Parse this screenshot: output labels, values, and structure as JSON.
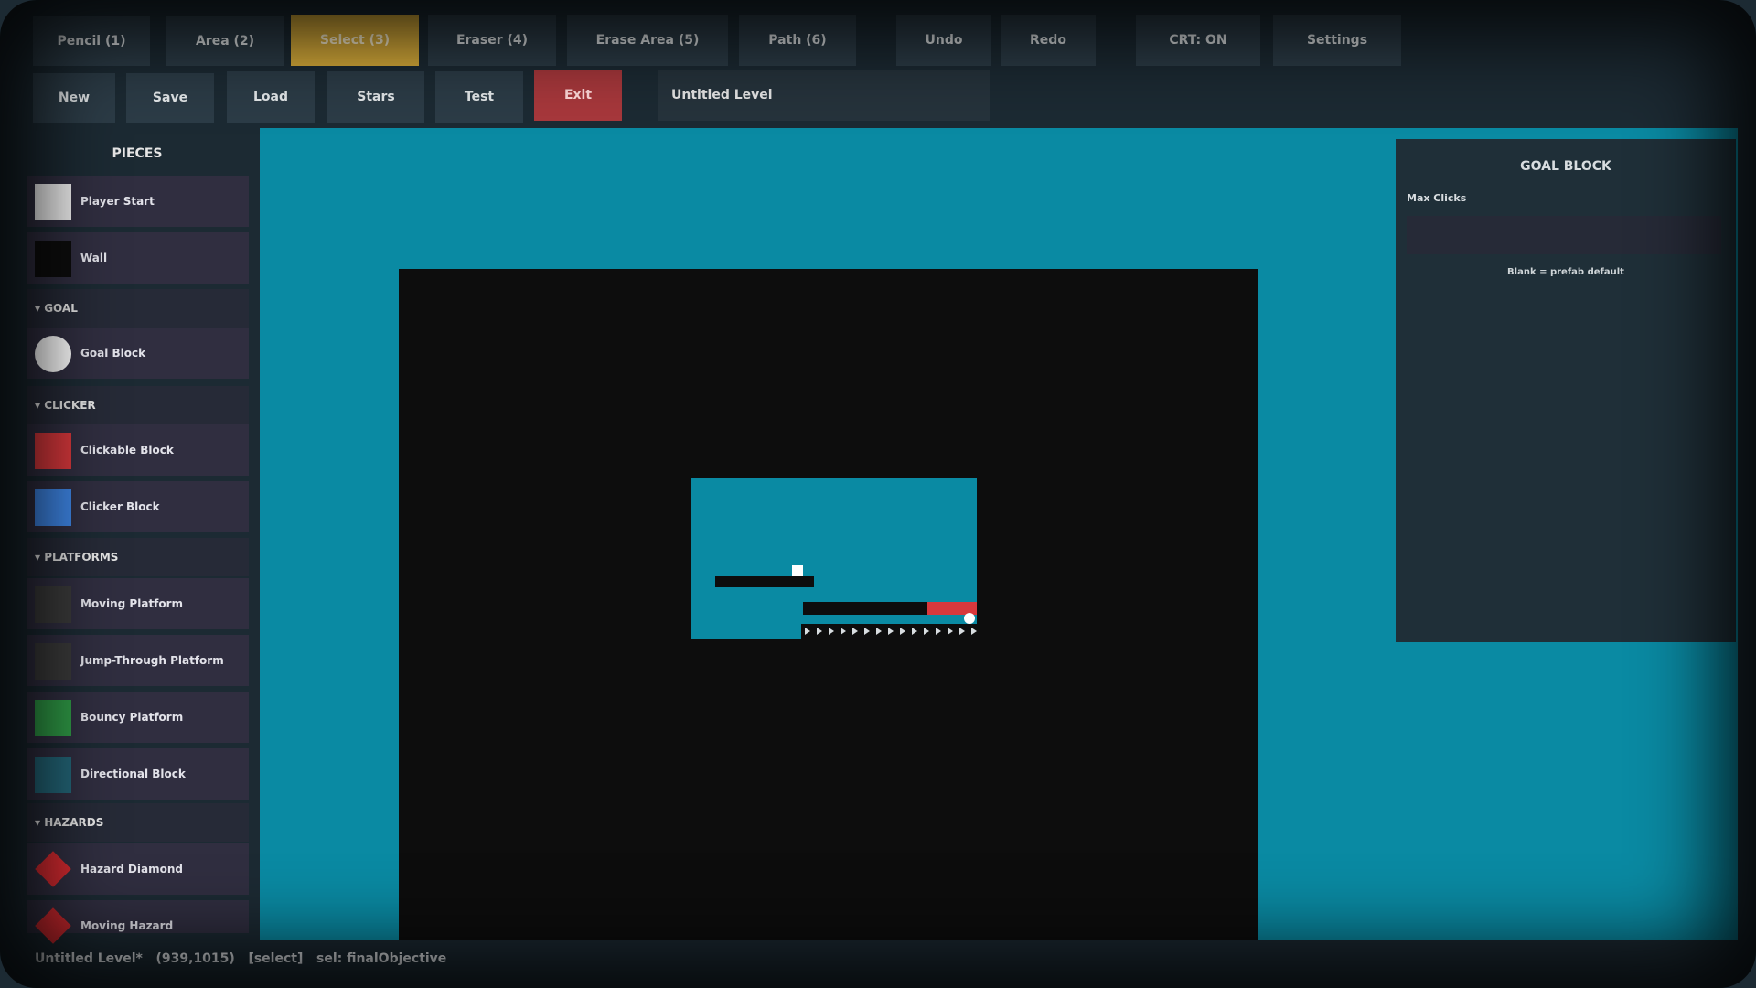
{
  "toolbar_row1": [
    {
      "label": "Pencil (1)",
      "active": false
    },
    {
      "label": "Area (2)",
      "active": false
    },
    {
      "label": "Select (3)",
      "active": true
    },
    {
      "label": "Eraser (4)",
      "active": false
    },
    {
      "label": "Erase Area (5)",
      "active": false
    },
    {
      "label": "Path (6)",
      "active": false
    },
    {
      "label": "Undo",
      "active": false
    },
    {
      "label": "Redo",
      "active": false
    },
    {
      "label": "CRT: ON",
      "active": false
    },
    {
      "label": "Settings",
      "active": false
    }
  ],
  "toolbar_row2": [
    {
      "label": "New"
    },
    {
      "label": "Save"
    },
    {
      "label": "Load"
    },
    {
      "label": "Stars"
    },
    {
      "label": "Test"
    },
    {
      "label": "Exit"
    }
  ],
  "level_name": "Untitled Level",
  "sidebar": {
    "title": "PIECES",
    "items": [
      {
        "type": "piece",
        "label": "Player Start",
        "color": "#f2f2f2",
        "icon": "square"
      },
      {
        "type": "piece",
        "label": "Wall",
        "color": "#0d0d0d",
        "icon": "square"
      },
      {
        "type": "category",
        "label": "▾ GOAL"
      },
      {
        "type": "piece",
        "label": "Goal Block",
        "color": "#ffffff",
        "icon": "circle"
      },
      {
        "type": "category",
        "label": "▾ CLICKER"
      },
      {
        "type": "piece",
        "label": "Clickable Block",
        "color": "#d8383c",
        "icon": "square"
      },
      {
        "type": "piece",
        "label": "Clicker Block",
        "color": "#3e86e6",
        "icon": "square"
      },
      {
        "type": "category",
        "label": "▾ PLATFORMS"
      },
      {
        "type": "piece",
        "label": "Moving Platform",
        "color": "#3a3a3a",
        "icon": "square"
      },
      {
        "type": "piece",
        "label": "Jump-Through Platform",
        "color": "#3a3a3a",
        "icon": "square"
      },
      {
        "type": "piece",
        "label": "Bouncy Platform",
        "color": "#2f9a46",
        "icon": "square"
      },
      {
        "type": "piece",
        "label": "Directional Block",
        "color": "#236577",
        "icon": "square"
      },
      {
        "type": "category",
        "label": "▾ HAZARDS"
      },
      {
        "type": "piece",
        "label": "Hazard Diamond",
        "color": "#d42a30",
        "icon": "diamond"
      },
      {
        "type": "piece",
        "label": "Moving Hazard",
        "color": "#d42a30",
        "icon": "diamond"
      }
    ]
  },
  "panel": {
    "title": "GOAL BLOCK",
    "field_label": "Max Clicks",
    "field_value": "",
    "hint": "Blank = prefab default"
  },
  "status": {
    "file": "Untitled Level*",
    "coords": "(939,1015)",
    "mode": "[select]",
    "selection": "sel: finalObjective"
  },
  "colors": {
    "canvas": "#0a8aa3",
    "level_bg": "#0d0d0d",
    "accent_active": "#d9ad3a",
    "danger": "#a8383c"
  }
}
